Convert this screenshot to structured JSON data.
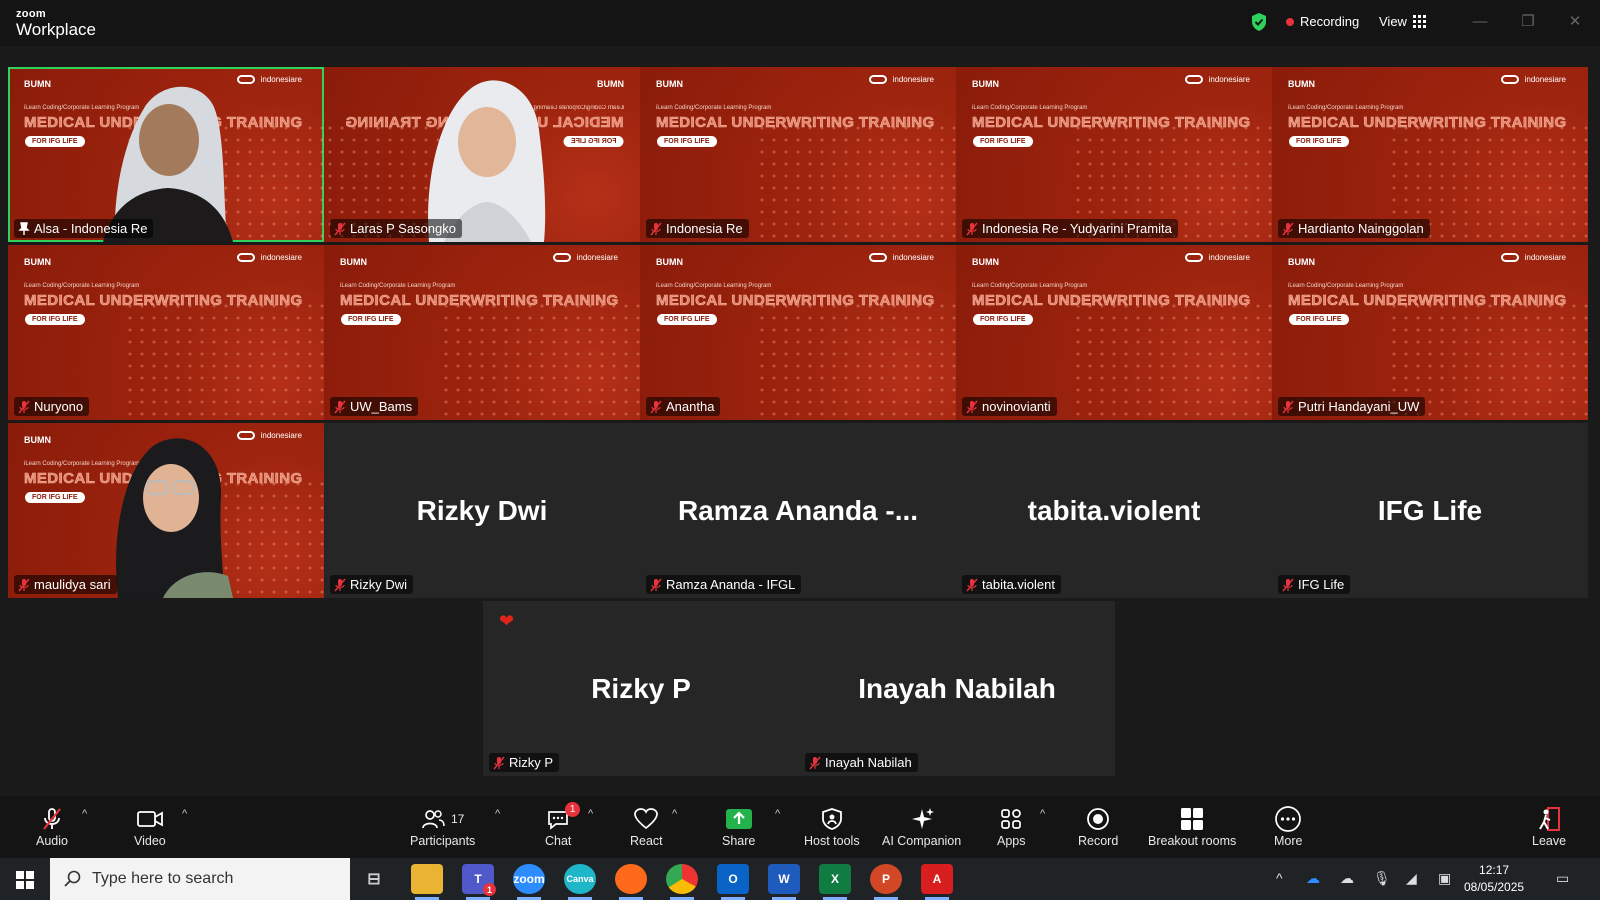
{
  "app": {
    "brand_small": "zoom",
    "brand_large": "Workplace"
  },
  "titlebar": {
    "recording_label": "Recording",
    "view_label": "View"
  },
  "slide": {
    "title": "MEDICAL UNDERWRITING TRAINING",
    "subtitle": "iLearn Coding/Corporate Learning Program",
    "pill": "FOR IFG LIFE",
    "left_logo": "BUMN",
    "right_logo": "indonesiare"
  },
  "participants_tiles": [
    {
      "name": "Alsa - Indonesia Re"
    },
    {
      "name": "Laras P Sasongko"
    },
    {
      "name": "Indonesia Re"
    },
    {
      "name": "Indonesia Re - Yudyarini Pramita"
    },
    {
      "name": "Hardianto Nainggolan"
    },
    {
      "name": "Nuryono"
    },
    {
      "name": "UW_Bams"
    },
    {
      "name": "Anantha"
    },
    {
      "name": "novinovianti"
    },
    {
      "name": "Putri Handayani_UW"
    },
    {
      "name": "maulidya sari"
    },
    {
      "name": "Rizky Dwi",
      "big": "Rizky Dwi"
    },
    {
      "name": "Ramza Ananda - IFGL",
      "big": "Ramza  Ananda  -..."
    },
    {
      "name": "tabita.violent",
      "big": "tabita.violent"
    },
    {
      "name": "IFG Life",
      "big": "IFG Life"
    },
    {
      "name": "Rizky P",
      "big": "Rizky P"
    },
    {
      "name": "Inayah Nabilah",
      "big": "Inayah Nabilah"
    }
  ],
  "toolbar": {
    "audio": "Audio",
    "video": "Video",
    "participants": "Participants",
    "participants_count": "17",
    "chat": "Chat",
    "chat_badge": "1",
    "react": "React",
    "share": "Share",
    "host_tools": "Host tools",
    "ai_companion": "AI Companion",
    "apps": "Apps",
    "record": "Record",
    "breakout": "Breakout rooms",
    "more": "More",
    "leave": "Leave"
  },
  "taskbar": {
    "search_placeholder": "Type here to search",
    "time": "12:17",
    "date": "08/05/2025",
    "teams_badge": "1"
  },
  "colors": {
    "active_speaker": "#2fd25a",
    "recording_dot": "#e8333c",
    "slide_red": "#9e240e",
    "share_green": "#23b24b"
  }
}
